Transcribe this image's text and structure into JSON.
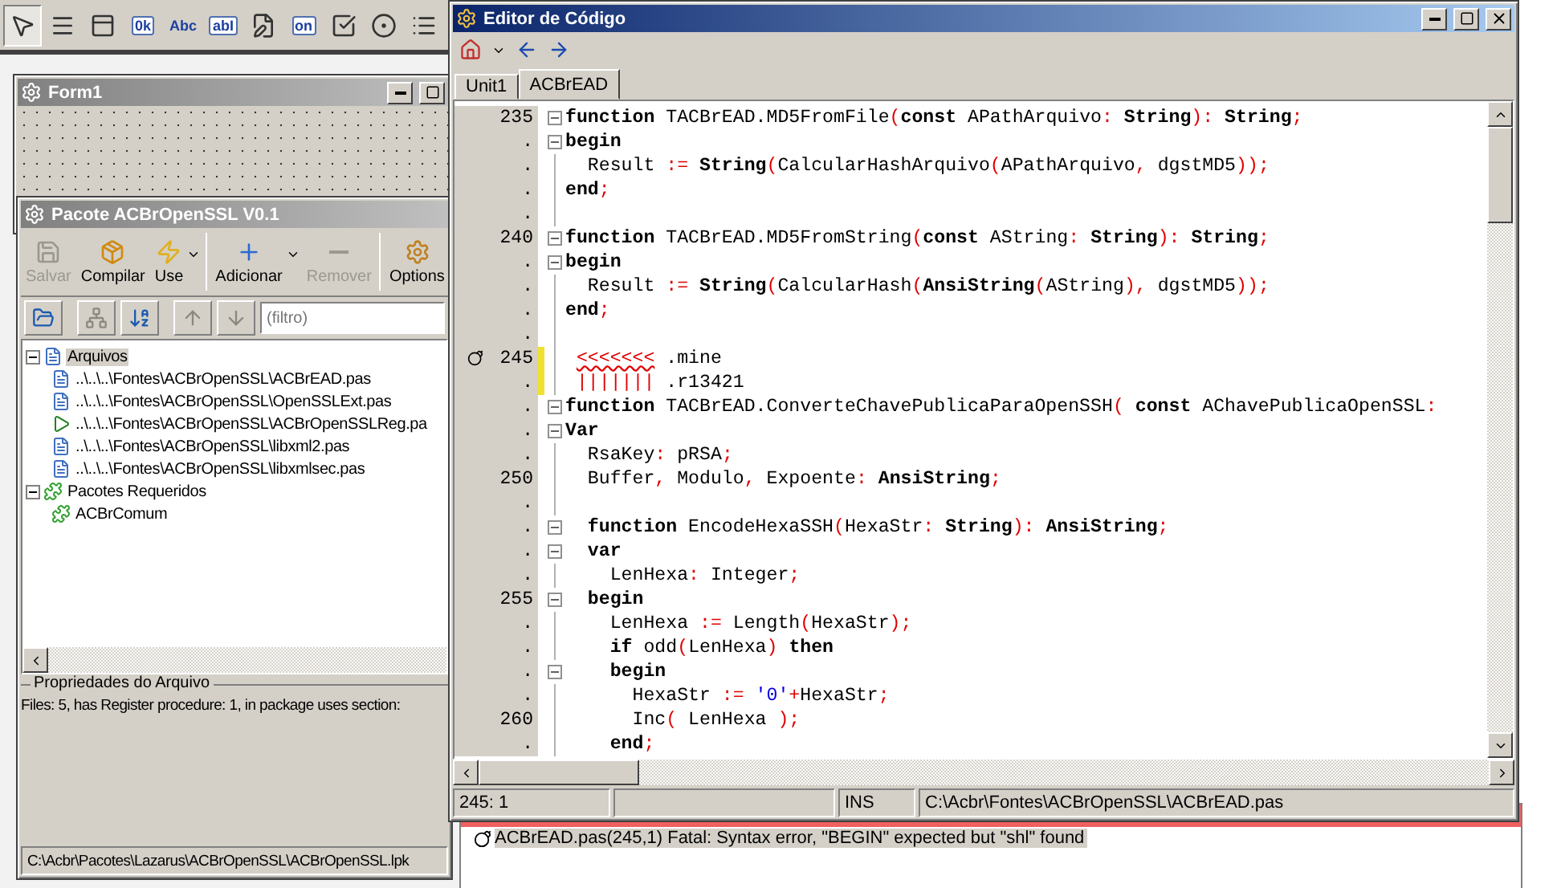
{
  "palette": [
    {
      "kind": "pointer",
      "selected": true
    },
    {
      "kind": "menu",
      "selected": false
    },
    {
      "kind": "popup",
      "selected": false
    },
    {
      "kind": "button",
      "label": "0k",
      "selected": false
    },
    {
      "kind": "label",
      "label": "Abc",
      "selected": false
    },
    {
      "kind": "edit",
      "label": "abI",
      "selected": false
    },
    {
      "kind": "memo",
      "selected": false
    },
    {
      "kind": "toggle",
      "label": "on",
      "selected": false
    },
    {
      "kind": "checkbox",
      "selected": false
    },
    {
      "kind": "radio",
      "selected": false
    },
    {
      "kind": "list",
      "selected": false
    }
  ],
  "form_window": {
    "title": "Form1"
  },
  "package_window": {
    "title": "Pacote ACBrOpenSSL V0.1",
    "toolbar": [
      {
        "label": "Salvar",
        "kind": "save",
        "disabled": true,
        "dropdown": false
      },
      {
        "label": "Compilar",
        "kind": "compile",
        "disabled": false,
        "dropdown": false
      },
      {
        "label": "Use",
        "kind": "use",
        "disabled": false,
        "dropdown": true
      },
      {
        "label": "Adicionar",
        "kind": "add",
        "disabled": false,
        "dropdown": true
      },
      {
        "label": "Remover",
        "kind": "remove",
        "disabled": true,
        "dropdown": false
      },
      {
        "label": "Options",
        "kind": "options",
        "disabled": false,
        "dropdown": false
      }
    ],
    "tool_buttons": [
      {
        "kind": "open",
        "disabled": false
      },
      {
        "kind": "tree",
        "disabled": true
      },
      {
        "kind": "sort",
        "disabled": false
      },
      {
        "kind": "up",
        "disabled": true
      },
      {
        "kind": "down",
        "disabled": true
      }
    ],
    "filter": {
      "placeholder": "(filtro)"
    },
    "tree": [
      {
        "label": "Arquivos",
        "kind": "files",
        "expanded": true,
        "selected": true,
        "children": [
          {
            "label": "..\\..\\..\\Fontes\\ACBrOpenSSL\\ACBrEAD.pas",
            "kind": "unit",
            "selected": false
          },
          {
            "label": "..\\..\\..\\Fontes\\ACBrOpenSSL\\OpenSSLExt.pas",
            "kind": "unit",
            "selected": false
          },
          {
            "label": "..\\..\\..\\Fontes\\ACBrOpenSSL\\ACBrOpenSSLReg.pa",
            "kind": "register",
            "selected": false
          },
          {
            "label": "..\\..\\..\\Fontes\\ACBrOpenSSL\\libxml2.pas",
            "kind": "unit",
            "selected": false
          },
          {
            "label": "..\\..\\..\\Fontes\\ACBrOpenSSL\\libxmlsec.pas",
            "kind": "unit",
            "selected": false
          }
        ]
      },
      {
        "label": "Pacotes Requeridos",
        "kind": "package",
        "expanded": true,
        "selected": false,
        "children": [
          {
            "label": "ACBrComum",
            "kind": "package",
            "selected": false
          }
        ]
      }
    ],
    "properties": {
      "title": "Propriedades do Arquivo",
      "text": "Files: 5, has Register procedure: 1, in package uses section:"
    },
    "status_bar": "C:\\Acbr\\Pacotes\\Lazarus\\ACBrOpenSSL\\ACBrOpenSSL.lpk"
  },
  "editor": {
    "title": "Editor de Código",
    "tabs": [
      {
        "label": "Unit1",
        "selected": false
      },
      {
        "label": "ACBrEAD",
        "selected": true
      }
    ],
    "lines": [
      {
        "number": "235",
        "fold": true,
        "modified": false,
        "error": false,
        "tokens": [
          {
            "kind": "keyword",
            "text": "function"
          },
          {
            "kind": "plain",
            "text": " TACBrEAD.MD5FromFile"
          },
          {
            "kind": "symbol",
            "text": "("
          },
          {
            "kind": "keyword",
            "text": "const"
          },
          {
            "kind": "plain",
            "text": " APathArquivo"
          },
          {
            "kind": "symbol",
            "text": ": "
          },
          {
            "kind": "keyword",
            "text": "String"
          },
          {
            "kind": "symbol",
            "text": "): "
          },
          {
            "kind": "keyword",
            "text": "String"
          },
          {
            "kind": "symbol",
            "text": ";"
          }
        ]
      },
      {
        "number": ".",
        "fold": true,
        "modified": false,
        "error": false,
        "tokens": [
          {
            "kind": "keyword",
            "text": "begin"
          }
        ]
      },
      {
        "number": ".",
        "fold": false,
        "modified": false,
        "error": false,
        "tokens": [
          {
            "kind": "plain",
            "text": "  Result "
          },
          {
            "kind": "symbol",
            "text": ":= "
          },
          {
            "kind": "keyword",
            "text": "String"
          },
          {
            "kind": "symbol",
            "text": "("
          },
          {
            "kind": "plain",
            "text": "CalcularHashArquivo"
          },
          {
            "kind": "symbol",
            "text": "("
          },
          {
            "kind": "plain",
            "text": "APathArquivo"
          },
          {
            "kind": "symbol",
            "text": ","
          },
          {
            "kind": "plain",
            "text": " dgstMD5"
          },
          {
            "kind": "symbol",
            "text": "));"
          }
        ]
      },
      {
        "number": ".",
        "fold": false,
        "modified": false,
        "error": false,
        "tokens": [
          {
            "kind": "keyword",
            "text": "end"
          },
          {
            "kind": "symbol",
            "text": ";"
          }
        ]
      },
      {
        "number": ".",
        "fold": false,
        "modified": false,
        "error": false
      },
      {
        "number": "240",
        "fold": true,
        "modified": false,
        "error": false,
        "tokens": [
          {
            "kind": "keyword",
            "text": "function"
          },
          {
            "kind": "plain",
            "text": " TACBrEAD.MD5FromString"
          },
          {
            "kind": "symbol",
            "text": "("
          },
          {
            "kind": "keyword",
            "text": "const"
          },
          {
            "kind": "plain",
            "text": " AString"
          },
          {
            "kind": "symbol",
            "text": ": "
          },
          {
            "kind": "keyword",
            "text": "String"
          },
          {
            "kind": "symbol",
            "text": "): "
          },
          {
            "kind": "keyword",
            "text": "String"
          },
          {
            "kind": "symbol",
            "text": ";"
          }
        ]
      },
      {
        "number": ".",
        "fold": true,
        "modified": false,
        "error": false,
        "tokens": [
          {
            "kind": "keyword",
            "text": "begin"
          }
        ]
      },
      {
        "number": ".",
        "fold": false,
        "modified": false,
        "error": false,
        "tokens": [
          {
            "kind": "plain",
            "text": "  Result "
          },
          {
            "kind": "symbol",
            "text": ":= "
          },
          {
            "kind": "keyword",
            "text": "String"
          },
          {
            "kind": "symbol",
            "text": "("
          },
          {
            "kind": "plain",
            "text": "CalcularHash"
          },
          {
            "kind": "symbol",
            "text": "("
          },
          {
            "kind": "keyword",
            "text": "AnsiString"
          },
          {
            "kind": "symbol",
            "text": "("
          },
          {
            "kind": "plain",
            "text": "AString"
          },
          {
            "kind": "symbol",
            "text": "),"
          },
          {
            "kind": "plain",
            "text": " dgstMD5"
          },
          {
            "kind": "symbol",
            "text": "));"
          }
        ]
      },
      {
        "number": ".",
        "fold": false,
        "modified": false,
        "error": false,
        "tokens": [
          {
            "kind": "keyword",
            "text": "end"
          },
          {
            "kind": "symbol",
            "text": ";"
          }
        ]
      },
      {
        "number": ".",
        "fold": false,
        "modified": false,
        "error": false
      },
      {
        "number": "245",
        "fold": false,
        "modified": true,
        "error": true,
        "tokens": [
          {
            "kind": "conflict",
            "text": "<<<<<<<"
          },
          {
            "kind": "plain",
            "text": " .mine"
          }
        ]
      },
      {
        "number": ".",
        "fold": false,
        "modified": true,
        "error": false,
        "tokens": [
          {
            "kind": "marker",
            "text": "|||||||"
          },
          {
            "kind": "plain",
            "text": " .r13421"
          }
        ]
      },
      {
        "number": ".",
        "fold": true,
        "modified": false,
        "error": false,
        "tokens": [
          {
            "kind": "keyword",
            "text": "function"
          },
          {
            "kind": "plain",
            "text": " TACBrEAD.ConverteChavePublicaParaOpenSSH"
          },
          {
            "kind": "symbol",
            "text": "( "
          },
          {
            "kind": "keyword",
            "text": "const"
          },
          {
            "kind": "plain",
            "text": " AChavePublicaOpenSSL"
          },
          {
            "kind": "symbol",
            "text": ":"
          }
        ]
      },
      {
        "number": ".",
        "fold": true,
        "modified": false,
        "error": false,
        "tokens": [
          {
            "kind": "keyword",
            "text": "Var"
          }
        ]
      },
      {
        "number": ".",
        "fold": false,
        "modified": false,
        "error": false,
        "tokens": [
          {
            "kind": "plain",
            "text": "  RsaKey"
          },
          {
            "kind": "symbol",
            "text": ":"
          },
          {
            "kind": "plain",
            "text": " pRSA"
          },
          {
            "kind": "symbol",
            "text": ";"
          }
        ]
      },
      {
        "number": "250",
        "fold": false,
        "modified": false,
        "error": false,
        "tokens": [
          {
            "kind": "plain",
            "text": "  Buffer"
          },
          {
            "kind": "symbol",
            "text": ","
          },
          {
            "kind": "plain",
            "text": " Modulo"
          },
          {
            "kind": "symbol",
            "text": ","
          },
          {
            "kind": "plain",
            "text": " Expoente"
          },
          {
            "kind": "symbol",
            "text": ": "
          },
          {
            "kind": "keyword",
            "text": "AnsiString"
          },
          {
            "kind": "symbol",
            "text": ";"
          }
        ]
      },
      {
        "number": ".",
        "fold": false,
        "modified": false,
        "error": false
      },
      {
        "number": ".",
        "fold": true,
        "modified": false,
        "error": false,
        "tokens": [
          {
            "kind": "keyword",
            "text": "  function"
          },
          {
            "kind": "plain",
            "text": " EncodeHexaSSH"
          },
          {
            "kind": "symbol",
            "text": "("
          },
          {
            "kind": "plain",
            "text": "HexaStr"
          },
          {
            "kind": "symbol",
            "text": ": "
          },
          {
            "kind": "keyword",
            "text": "String"
          },
          {
            "kind": "symbol",
            "text": "): "
          },
          {
            "kind": "keyword",
            "text": "AnsiString"
          },
          {
            "kind": "symbol",
            "text": ";"
          }
        ]
      },
      {
        "number": ".",
        "fold": true,
        "modified": false,
        "error": false,
        "tokens": [
          {
            "kind": "keyword",
            "text": "  var"
          }
        ]
      },
      {
        "number": ".",
        "fold": false,
        "modified": false,
        "error": false,
        "tokens": [
          {
            "kind": "plain",
            "text": "    LenHexa"
          },
          {
            "kind": "symbol",
            "text": ":"
          },
          {
            "kind": "plain",
            "text": " Integer"
          },
          {
            "kind": "symbol",
            "text": ";"
          }
        ]
      },
      {
        "number": "255",
        "fold": true,
        "modified": false,
        "error": false,
        "tokens": [
          {
            "kind": "keyword",
            "text": "  begin"
          }
        ]
      },
      {
        "number": ".",
        "fold": false,
        "modified": false,
        "error": false,
        "tokens": [
          {
            "kind": "plain",
            "text": "    LenHexa "
          },
          {
            "kind": "symbol",
            "text": ":="
          },
          {
            "kind": "plain",
            "text": " Length"
          },
          {
            "kind": "symbol",
            "text": "("
          },
          {
            "kind": "plain",
            "text": "HexaStr"
          },
          {
            "kind": "symbol",
            "text": ");"
          }
        ]
      },
      {
        "number": ".",
        "fold": false,
        "modified": false,
        "error": false,
        "tokens": [
          {
            "kind": "keyword",
            "text": "    if"
          },
          {
            "kind": "plain",
            "text": " odd"
          },
          {
            "kind": "symbol",
            "text": "("
          },
          {
            "kind": "plain",
            "text": "LenHexa"
          },
          {
            "kind": "symbol",
            "text": ") "
          },
          {
            "kind": "keyword",
            "text": "then"
          }
        ]
      },
      {
        "number": ".",
        "fold": true,
        "modified": false,
        "error": false,
        "tokens": [
          {
            "kind": "keyword",
            "text": "    begin"
          }
        ]
      },
      {
        "number": ".",
        "fold": false,
        "modified": false,
        "error": false,
        "tokens": [
          {
            "kind": "plain",
            "text": "      HexaStr "
          },
          {
            "kind": "symbol",
            "text": ":= "
          },
          {
            "kind": "string",
            "text": "'0'"
          },
          {
            "kind": "symbol",
            "text": "+"
          },
          {
            "kind": "plain",
            "text": "HexaStr"
          },
          {
            "kind": "symbol",
            "text": ";"
          }
        ]
      },
      {
        "number": "260",
        "fold": false,
        "modified": false,
        "error": false,
        "tokens": [
          {
            "kind": "plain",
            "text": "      Inc"
          },
          {
            "kind": "symbol",
            "text": "("
          },
          {
            "kind": "plain",
            "text": " LenHexa "
          },
          {
            "kind": "symbol",
            "text": ");"
          }
        ]
      },
      {
        "number": ".",
        "fold": false,
        "modified": false,
        "error": false,
        "tokens": [
          {
            "kind": "keyword",
            "text": "    end"
          },
          {
            "kind": "symbol",
            "text": ";"
          }
        ]
      }
    ],
    "status": {
      "position": "245: 1",
      "mode": "INS",
      "file": "C:\\Acbr\\Fontes\\ACBrOpenSSL\\ACBrEAD.pas"
    }
  },
  "messages": [
    {
      "kind": "error",
      "text": "ACBrEAD.pas(245,1) Fatal: Syntax error, \"BEGIN\" expected but \"shl\" found",
      "selected": true
    }
  ]
}
